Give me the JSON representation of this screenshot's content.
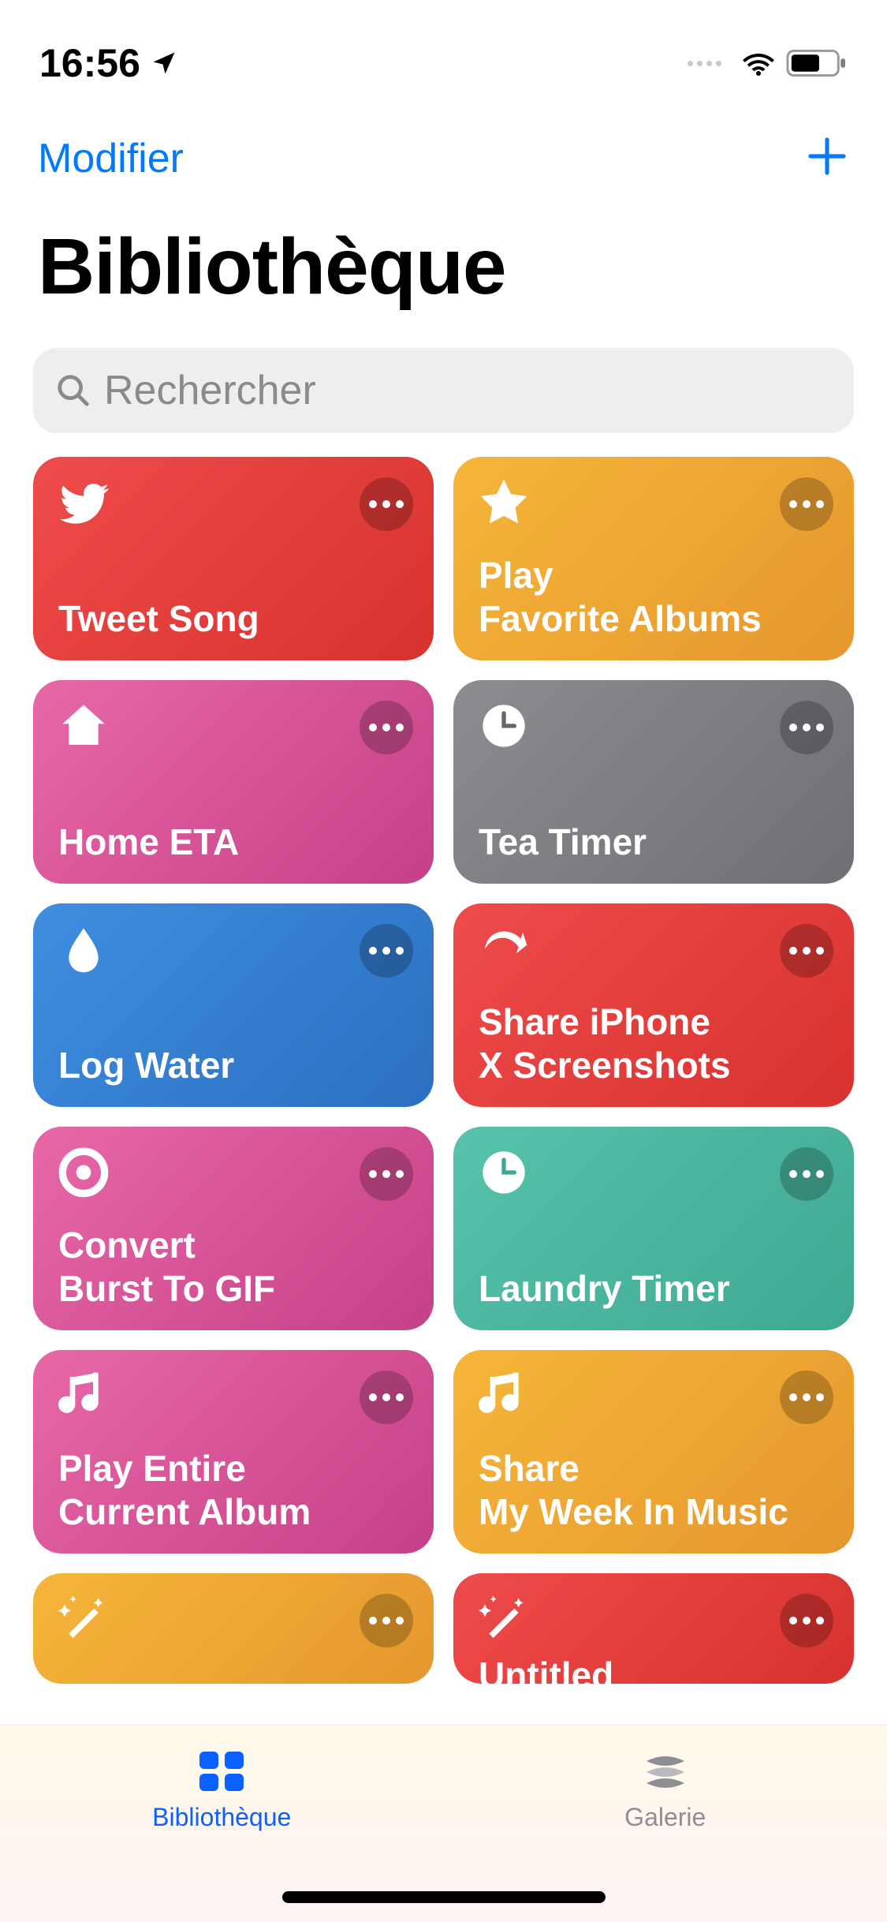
{
  "status": {
    "time": "16:56"
  },
  "nav": {
    "edit": "Modifier"
  },
  "title": "Bibliothèque",
  "search": {
    "placeholder": "Rechercher"
  },
  "shortcuts": [
    {
      "title": "Tweet Song",
      "icon": "twitter",
      "gradient": "g-red"
    },
    {
      "title": "Play\nFavorite Albums",
      "icon": "star",
      "gradient": "g-orange"
    },
    {
      "title": "Home ETA",
      "icon": "home",
      "gradient": "g-pink"
    },
    {
      "title": "Tea Timer",
      "icon": "clock",
      "gradient": "g-gray"
    },
    {
      "title": "Log Water",
      "icon": "drop",
      "gradient": "g-blue"
    },
    {
      "title": "Share iPhone\nX Screenshots",
      "icon": "share",
      "gradient": "g-red"
    },
    {
      "title": "Convert\nBurst To GIF",
      "icon": "target",
      "gradient": "g-pink"
    },
    {
      "title": "Laundry Timer",
      "icon": "clock",
      "gradient": "g-teal"
    },
    {
      "title": "Play Entire\nCurrent Album",
      "icon": "music",
      "gradient": "g-pink"
    },
    {
      "title": "Share\nMy Week In Music",
      "icon": "music",
      "gradient": "g-orange"
    },
    {
      "title": "",
      "icon": "wand",
      "gradient": "g-orange"
    },
    {
      "title": "Untitled",
      "icon": "wand",
      "gradient": "g-red"
    }
  ],
  "tabs": {
    "library": "Bibliothèque",
    "gallery": "Galerie"
  }
}
